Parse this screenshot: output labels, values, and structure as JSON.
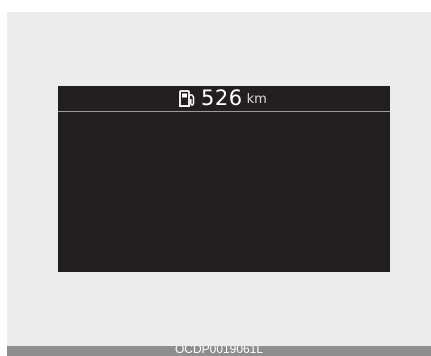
{
  "display": {
    "range_value": "526",
    "range_unit": "km",
    "fuel_icon": "fuel-pump-icon"
  },
  "caption": {
    "code": "OCDP0019061L"
  },
  "colors": {
    "screen_background": "#231f20",
    "frame_background": "#ececec",
    "caption_background": "#8e8e8e",
    "text": "#ffffff"
  }
}
